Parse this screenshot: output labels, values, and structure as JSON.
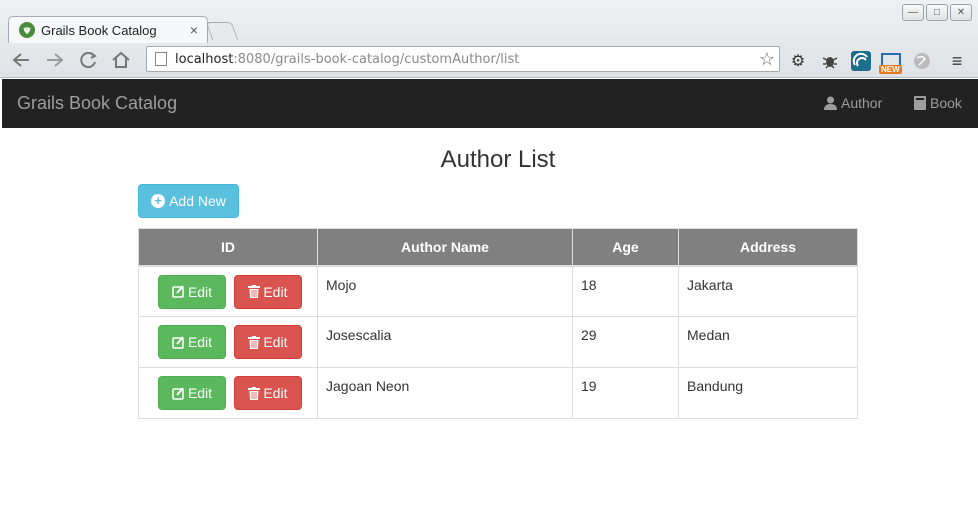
{
  "browser": {
    "tab_title": "Grails Book Catalog",
    "tab_close": "×",
    "url_host": "localhost",
    "url_rest": ":8080/grails-book-catalog/customAuthor/list",
    "ext_badge": "NEW"
  },
  "navbar": {
    "brand": "Grails Book Catalog",
    "links": [
      {
        "label": "Author",
        "icon": "user-icon"
      },
      {
        "label": "Book",
        "icon": "book-icon"
      }
    ]
  },
  "main": {
    "title": "Author List",
    "add_button": "Add New",
    "table": {
      "headers": [
        "ID",
        "Author Name",
        "Age",
        "Address"
      ],
      "rows": [
        {
          "name": "Mojo",
          "age": "18",
          "address": "Jakarta",
          "edit_label": "Edit",
          "delete_label": "Edit"
        },
        {
          "name": "Josescalia",
          "age": "29",
          "address": "Medan",
          "edit_label": "Edit",
          "delete_label": "Edit"
        },
        {
          "name": "Jagoan Neon",
          "age": "19",
          "address": "Bandung",
          "edit_label": "Edit",
          "delete_label": "Edit"
        }
      ]
    }
  },
  "colors": {
    "navbar_bg": "#222222",
    "info": "#5bc0de",
    "success": "#5cb85c",
    "danger": "#d9534f",
    "table_header": "#808080"
  }
}
